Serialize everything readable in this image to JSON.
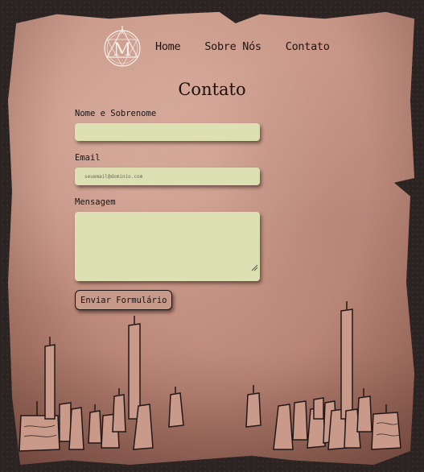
{
  "logo": {
    "monogram": "M"
  },
  "nav": {
    "items": [
      {
        "label": "Home"
      },
      {
        "label": "Sobre Nós"
      },
      {
        "label": "Contato"
      }
    ]
  },
  "page": {
    "title": "Contato"
  },
  "form": {
    "name_label": "Nome e Sobrenome",
    "name_value": "",
    "email_label": "Email",
    "email_placeholder": "seuemail@dominio.com",
    "message_label": "Mensagem",
    "message_value": "",
    "submit_label": "Enviar Formulário"
  },
  "colors": {
    "parchment": "#c99a8a",
    "background": "#2c2422",
    "field": "#dde0b2",
    "ink": "#1a1110"
  },
  "icons": [
    "logo-emblem-icon",
    "resize-grip-icon",
    "candles-illustration"
  ]
}
